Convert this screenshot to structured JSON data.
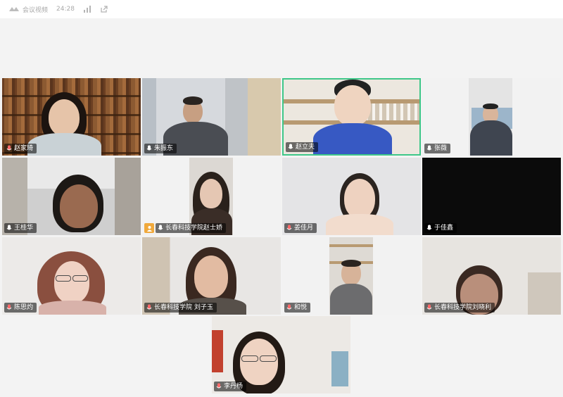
{
  "window": {
    "app_title": "会议视频",
    "timer": "24:28",
    "icons": [
      "tencent-meeting-logo",
      "signal-icon",
      "share-icon"
    ]
  },
  "participants": [
    {
      "name": "赵家琦",
      "mic": "unmuted",
      "active": false
    },
    {
      "name": "朱振东",
      "mic": "muted",
      "active": false
    },
    {
      "name": "赵立夫",
      "mic": "muted",
      "active": true
    },
    {
      "name": "张薇",
      "mic": "muted",
      "active": false
    },
    {
      "name": "王桂华",
      "mic": "muted",
      "active": false
    },
    {
      "name": "长春科技学院赵士娇",
      "mic": "muted",
      "active": false,
      "host": true
    },
    {
      "name": "姜佳月",
      "mic": "unmuted",
      "active": false
    },
    {
      "name": "于佳鑫",
      "mic": "muted",
      "active": false,
      "video_off": true
    },
    {
      "name": "陈思灼",
      "mic": "unmuted",
      "active": false
    },
    {
      "name": "长春科技学院 刘子玉",
      "mic": "unmuted",
      "active": false
    },
    {
      "name": "和悦",
      "mic": "unmuted",
      "active": false
    },
    {
      "name": "长春科技学院刘晓利",
      "mic": "unmuted",
      "active": false
    },
    {
      "name": "李丹杨",
      "mic": "unmuted",
      "active": false
    }
  ],
  "colors": {
    "active_border": "#3ec789",
    "host_badge": "#f0a93c",
    "muted_mic": "#ffffff",
    "unmuted_mic": "#ff6a6a"
  }
}
